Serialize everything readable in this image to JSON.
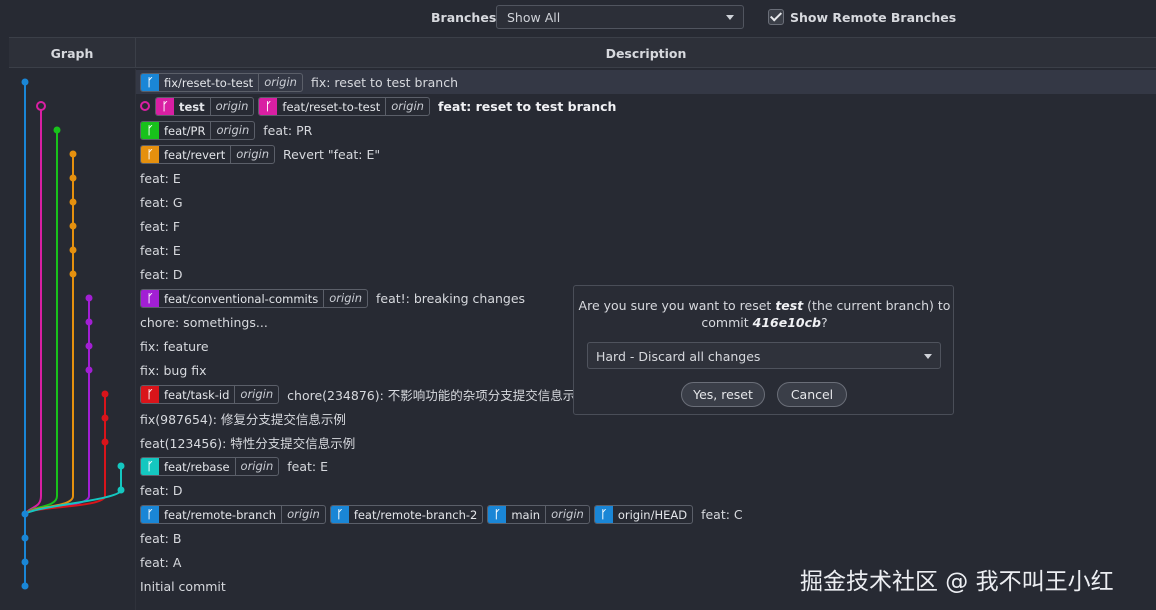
{
  "toolbar": {
    "branches_label": "Branches:",
    "branches_value": "Show All",
    "show_remote_label": "Show Remote Branches",
    "show_remote_checked": true
  },
  "columns": {
    "graph": "Graph",
    "description": "Description"
  },
  "colors": {
    "blue": "#1a86d6",
    "magenta": "#d91fa3",
    "green": "#18c21b",
    "orange": "#e5900e",
    "purple": "#a21fd4",
    "red": "#d9141a",
    "cyan": "#14c7c0"
  },
  "commits": [
    {
      "refs": [
        {
          "name": "fix/reset-to-test",
          "remote": "origin",
          "color": "#1a86d6"
        }
      ],
      "message": "fix: reset to test branch"
    },
    {
      "head": true,
      "refs": [
        {
          "name": "test",
          "remote": "origin",
          "color": "#d91fa3",
          "current": true
        },
        {
          "name": "feat/reset-to-test",
          "remote": "origin",
          "color": "#d91fa3"
        }
      ],
      "message": "feat: reset to test branch",
      "bold": true
    },
    {
      "refs": [
        {
          "name": "feat/PR",
          "remote": "origin",
          "color": "#18c21b"
        }
      ],
      "message": "feat: PR"
    },
    {
      "refs": [
        {
          "name": "feat/revert",
          "remote": "origin",
          "color": "#e5900e"
        }
      ],
      "message": "Revert \"feat: E\""
    },
    {
      "refs": [],
      "message": "feat: E"
    },
    {
      "refs": [],
      "message": "feat: G"
    },
    {
      "refs": [],
      "message": "feat: F"
    },
    {
      "refs": [],
      "message": "feat: E"
    },
    {
      "refs": [],
      "message": "feat: D"
    },
    {
      "refs": [
        {
          "name": "feat/conventional-commits",
          "remote": "origin",
          "color": "#a21fd4"
        }
      ],
      "message": "feat!: breaking changes"
    },
    {
      "refs": [],
      "message": "chore: somethings..."
    },
    {
      "refs": [],
      "message": "fix: feature"
    },
    {
      "refs": [],
      "message": "fix: bug fix"
    },
    {
      "refs": [
        {
          "name": "feat/task-id",
          "remote": "origin",
          "color": "#d9141a"
        }
      ],
      "message": "chore(234876): 不影响功能的杂项分支提交信息示例"
    },
    {
      "refs": [],
      "message": "fix(987654): 修复分支提交信息示例"
    },
    {
      "refs": [],
      "message": "feat(123456): 特性分支提交信息示例"
    },
    {
      "refs": [
        {
          "name": "feat/rebase",
          "remote": "origin",
          "color": "#14c7c0"
        }
      ],
      "message": "feat: E"
    },
    {
      "refs": [],
      "message": "feat: D"
    },
    {
      "refs": [
        {
          "name": "feat/remote-branch",
          "remote": "origin",
          "color": "#1a86d6"
        },
        {
          "name": "feat/remote-branch-2",
          "remote": "",
          "color": "#1a86d6"
        },
        {
          "name": "main",
          "remote": "origin",
          "color": "#1a86d6"
        },
        {
          "name": "origin/HEAD",
          "remote": "",
          "color": "#1a86d6"
        }
      ],
      "message": "feat: C"
    },
    {
      "refs": [],
      "message": "feat: B"
    },
    {
      "refs": [],
      "message": "feat: A"
    },
    {
      "refs": [],
      "message": "Initial commit"
    }
  ],
  "dialog": {
    "question_prefix": "Are you sure you want to reset ",
    "branch": "test",
    "question_middle": " (the current branch) to",
    "question_line2_prefix": "commit ",
    "commit": "416e10cb",
    "question_suffix": "?",
    "mode": "Hard - Discard all changes",
    "confirm_label": "Yes, reset",
    "cancel_label": "Cancel"
  },
  "watermark": "掘金技术社区 @ 我不叫王小红"
}
